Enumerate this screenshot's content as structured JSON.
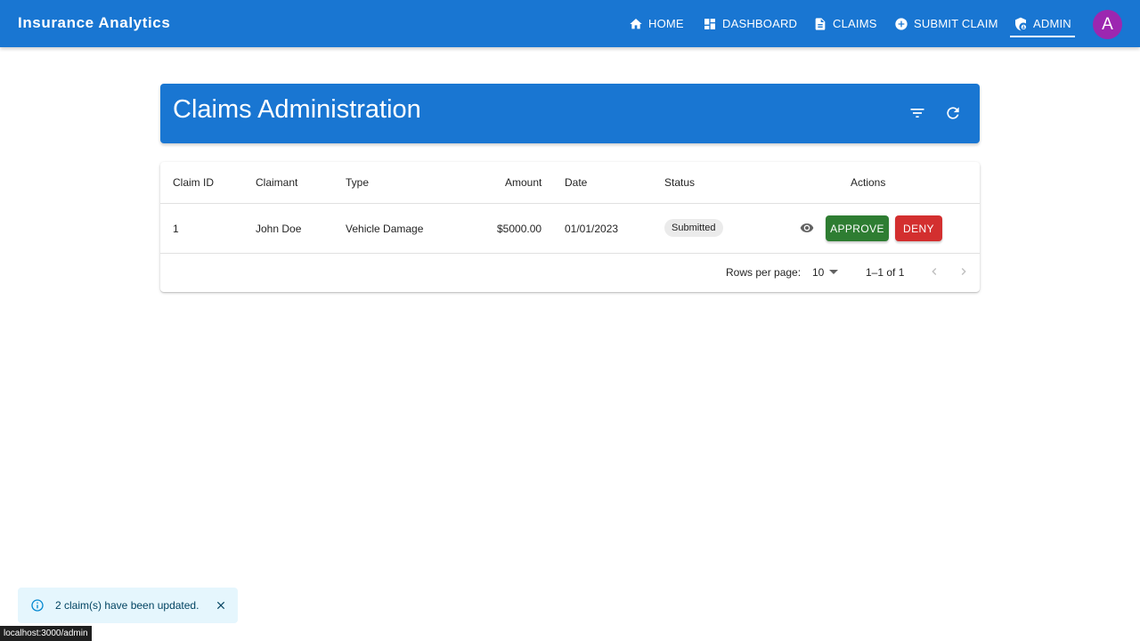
{
  "app": {
    "title": "Insurance Analytics"
  },
  "nav": {
    "items": [
      {
        "label": "HOME",
        "icon": "home-icon"
      },
      {
        "label": "DASHBOARD",
        "icon": "dashboard-icon"
      },
      {
        "label": "CLAIMS",
        "icon": "document-icon"
      },
      {
        "label": "SUBMIT CLAIM",
        "icon": "add-circle-icon"
      },
      {
        "label": "ADMIN",
        "icon": "admin-shield-icon",
        "active": true
      }
    ],
    "avatar": "A"
  },
  "header": {
    "title": "Claims Administration",
    "filter_icon": "filter-icon",
    "refresh_icon": "refresh-icon"
  },
  "table": {
    "columns": [
      "Claim ID",
      "Claimant",
      "Type",
      "Amount",
      "Date",
      "Status",
      "Actions"
    ],
    "rows": [
      {
        "claim_id": "1",
        "claimant": "John Doe",
        "type": "Vehicle Damage",
        "amount": "$5000.00",
        "date": "01/01/2023",
        "status": "Submitted",
        "approve_label": "APPROVE",
        "deny_label": "DENY"
      }
    ],
    "pagination": {
      "rows_per_page_label": "Rows per page:",
      "rows_per_page": "10",
      "range": "1–1 of 1"
    }
  },
  "snackbar": {
    "message": "2 claim(s) have been updated."
  },
  "status_bar": {
    "url": "localhost:3000/admin"
  },
  "colors": {
    "primary": "#1976d2",
    "approve": "#2e7d32",
    "deny": "#d32f2f",
    "avatar": "#9c27b0",
    "info_bg": "#e5f6fd"
  }
}
